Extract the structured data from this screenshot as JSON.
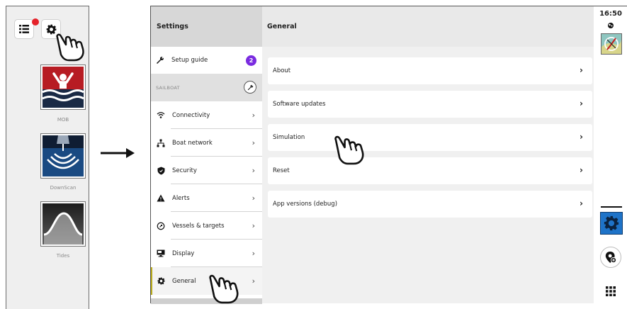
{
  "launcher": {
    "menu_button": "list-menu-icon",
    "settings_button": "gear-icon",
    "apps": [
      {
        "label": "MOB",
        "icon": "man-overboard-icon"
      },
      {
        "label": "DownScan",
        "icon": "downscan-sonar-icon"
      },
      {
        "label": "Tides",
        "icon": "tides-wave-icon"
      }
    ]
  },
  "settings": {
    "title": "Settings",
    "setup_guide": {
      "label": "Setup guide",
      "count": "2"
    },
    "group_label": "SAILBOAT",
    "menu": [
      {
        "label": "Connectivity",
        "icon": "wifi-icon"
      },
      {
        "label": "Boat network",
        "icon": "network-icon"
      },
      {
        "label": "Security",
        "icon": "shield-icon"
      },
      {
        "label": "Alerts",
        "icon": "alert-icon"
      },
      {
        "label": "Vessels & targets",
        "icon": "target-icon"
      },
      {
        "label": "Display",
        "icon": "display-icon"
      },
      {
        "label": "General",
        "icon": "gear-icon",
        "active": true
      }
    ]
  },
  "general": {
    "title": "General",
    "items": [
      "About",
      "Software updates",
      "Simulation",
      "Reset",
      "App versions (debug)"
    ]
  },
  "status": {
    "time": "16:50"
  },
  "colors": {
    "badge_purple": "#7a2be0",
    "notification_red": "#e5232b",
    "active_accent": "#b7a91b",
    "rail_gear_blue": "#1e73c8"
  }
}
